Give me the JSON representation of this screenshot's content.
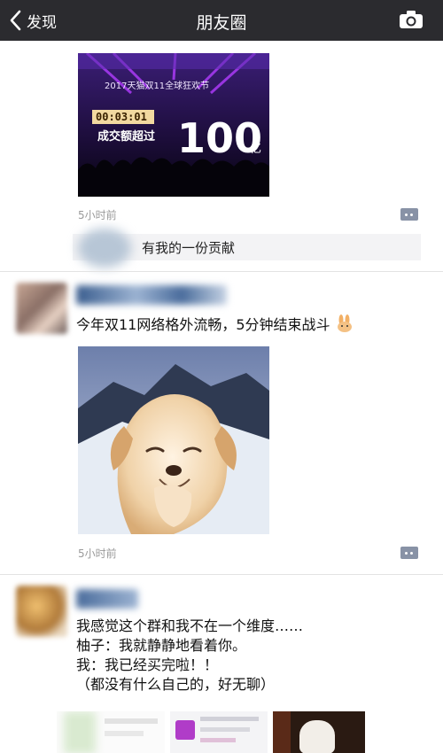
{
  "nav": {
    "back_label": "发现",
    "title": "朋友圈",
    "bar_color": "#2b2b2f"
  },
  "post1": {
    "image_banner": "2017天猫双11全球狂欢节",
    "image_counter": "00:03:01",
    "image_caption": "成交额超过",
    "image_big_number": "100",
    "image_unit": "亿",
    "time": "5小时前",
    "comment_text": "有我的一份贡献"
  },
  "post2": {
    "text": "今年双11网络格外流畅，5分钟结束战斗",
    "emoji_icon": "rabbit-icon",
    "time": "5小时前"
  },
  "post3": {
    "lines": [
      "我感觉这个群和我不在一个维度……",
      "柚子：我就静静地看着你。",
      "我：我已经买完啦！！",
      "（都没有什么自己的，好无聊）"
    ]
  }
}
